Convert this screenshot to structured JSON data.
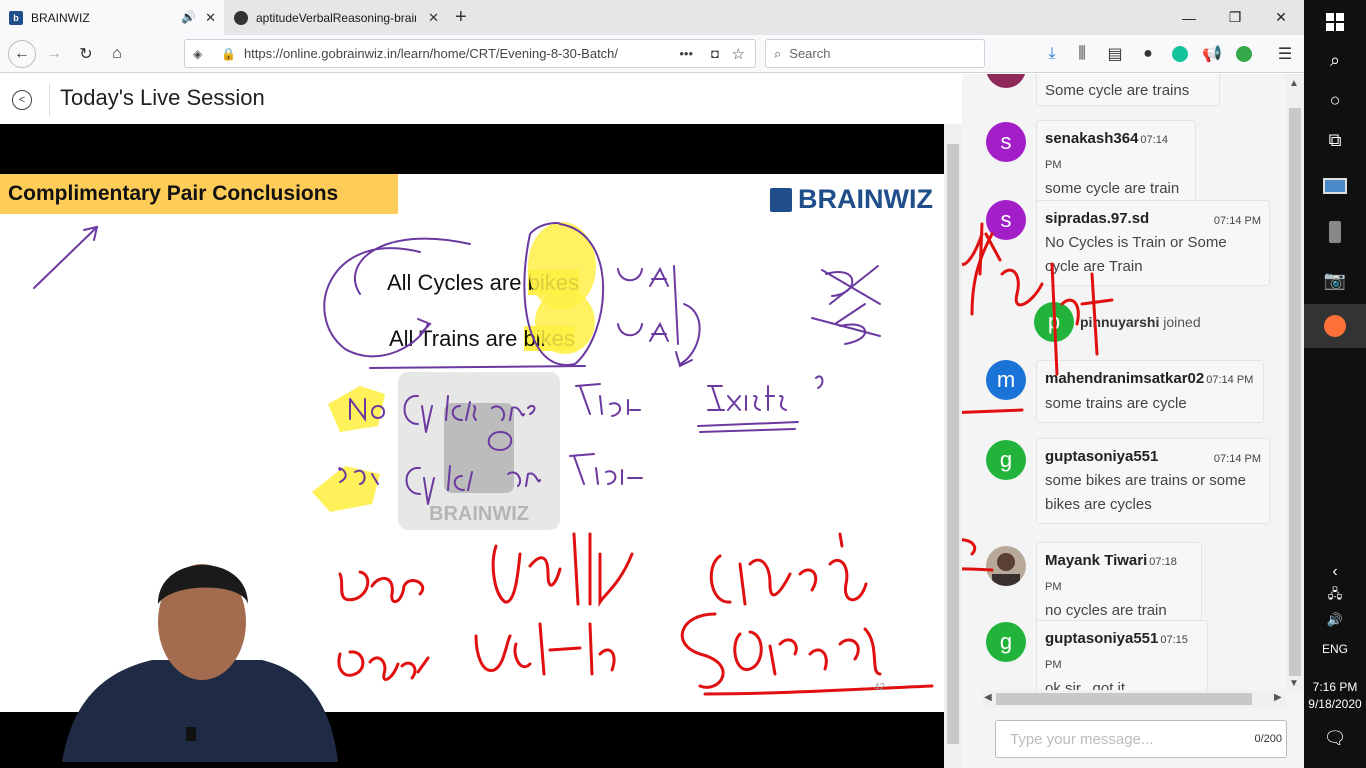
{
  "browser": {
    "tabs": [
      {
        "title": "BRAINWIZ",
        "active": true
      },
      {
        "title": "aptitudeVerbalReasoning-brain",
        "active": false
      }
    ],
    "url": "https://online.gobrainwiz.in/learn/home/CRT/Evening-8-30-Batch/",
    "search_placeholder": "Search"
  },
  "page": {
    "title": "Today's Live Session"
  },
  "slide": {
    "heading": "Complimentary Pair Conclusions",
    "logo_text": "BRAINWIZ",
    "statement1_prefix": "All Cycles are ",
    "statement1_hl": "bikes",
    "statement2_prefix": "All Trains are ",
    "statement2_hl": "bikes",
    "watermark": "BRAINWIZ",
    "page_number": "42"
  },
  "chat": {
    "messages": [
      {
        "avatar": "",
        "color": "#8e2a5a",
        "user": "",
        "time": "",
        "text": "Some cycle are trains"
      },
      {
        "avatar": "s",
        "color": "#a21fc8",
        "user": "senakash364",
        "time": "07:14 PM",
        "text": "some cycle are train"
      },
      {
        "avatar": "s",
        "color": "#a21fc8",
        "user": "sipradas.97.sd",
        "time": "07:14 PM",
        "text": "No Cycles is Train or Some cycle are Train"
      },
      {
        "avatar": "p",
        "color": "#22b43a",
        "user": "pinnuyarshi",
        "time": "",
        "text": "joined"
      },
      {
        "avatar": "m",
        "color": "#1a73d6",
        "user": "mahendranimsatkar02",
        "time": "07:14 PM",
        "text": "some trains are cycle"
      },
      {
        "avatar": "g",
        "color": "#22b43a",
        "user": "guptasoniya551",
        "time": "07:14 PM",
        "text": "some bikes are trains or some bikes are cycles"
      },
      {
        "avatar": "",
        "color": "#7a6a60",
        "user": "Mayank Tiwari",
        "time": "07:18 PM",
        "text": "no cycles are train"
      },
      {
        "avatar": "g",
        "color": "#22b43a",
        "user": "guptasoniya551",
        "time": "07:15 PM",
        "text": "ok sir.. got it"
      }
    ],
    "input_placeholder": "Type your message...",
    "char_count": "0/200"
  },
  "taskbar": {
    "language": "ENG",
    "time": "7:16 PM",
    "date": "9/18/2020"
  },
  "colors": {
    "ink_red": "#e01010",
    "ink_purple": "#6a3aa0",
    "highlight_yellow": "#fff047",
    "header_yellow": "#fecd57"
  }
}
